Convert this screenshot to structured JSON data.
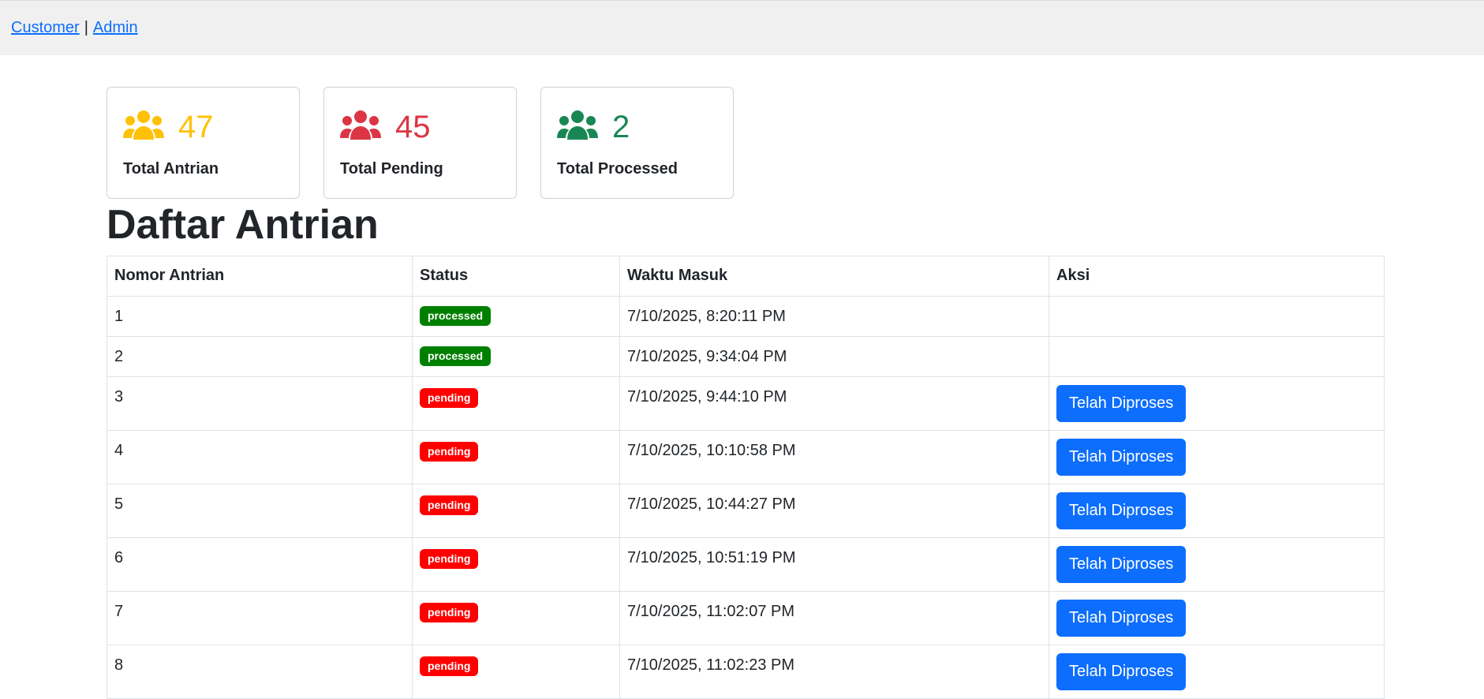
{
  "nav": {
    "customer_label": "Customer",
    "separator": "|",
    "admin_label": "Admin"
  },
  "colors": {
    "yellow": "#ffc107",
    "red": "#dc3545",
    "green": "#198754",
    "badge_processed": "#008000",
    "badge_pending": "#ff0000",
    "button": "#0d6efd"
  },
  "stats": [
    {
      "icon": "users-icon",
      "value": "47",
      "label": "Total Antrian",
      "color": "#ffc107"
    },
    {
      "icon": "users-icon",
      "value": "45",
      "label": "Total Pending",
      "color": "#dc3545"
    },
    {
      "icon": "users-icon",
      "value": "2",
      "label": "Total Processed",
      "color": "#198754"
    }
  ],
  "page_title": "Daftar Antrian",
  "table": {
    "headers": [
      "Nomor Antrian",
      "Status",
      "Waktu Masuk",
      "Aksi"
    ],
    "rows": [
      {
        "no": "1",
        "status": "processed",
        "time": "7/10/2025, 8:20:11 PM",
        "action": ""
      },
      {
        "no": "2",
        "status": "processed",
        "time": "7/10/2025, 9:34:04 PM",
        "action": ""
      },
      {
        "no": "3",
        "status": "pending",
        "time": "7/10/2025, 9:44:10 PM",
        "action": "Telah Diproses"
      },
      {
        "no": "4",
        "status": "pending",
        "time": "7/10/2025, 10:10:58 PM",
        "action": "Telah Diproses"
      },
      {
        "no": "5",
        "status": "pending",
        "time": "7/10/2025, 10:44:27 PM",
        "action": "Telah Diproses"
      },
      {
        "no": "6",
        "status": "pending",
        "time": "7/10/2025, 10:51:19 PM",
        "action": "Telah Diproses"
      },
      {
        "no": "7",
        "status": "pending",
        "time": "7/10/2025, 11:02:07 PM",
        "action": "Telah Diproses"
      },
      {
        "no": "8",
        "status": "pending",
        "time": "7/10/2025, 11:02:23 PM",
        "action": "Telah Diproses"
      }
    ]
  }
}
